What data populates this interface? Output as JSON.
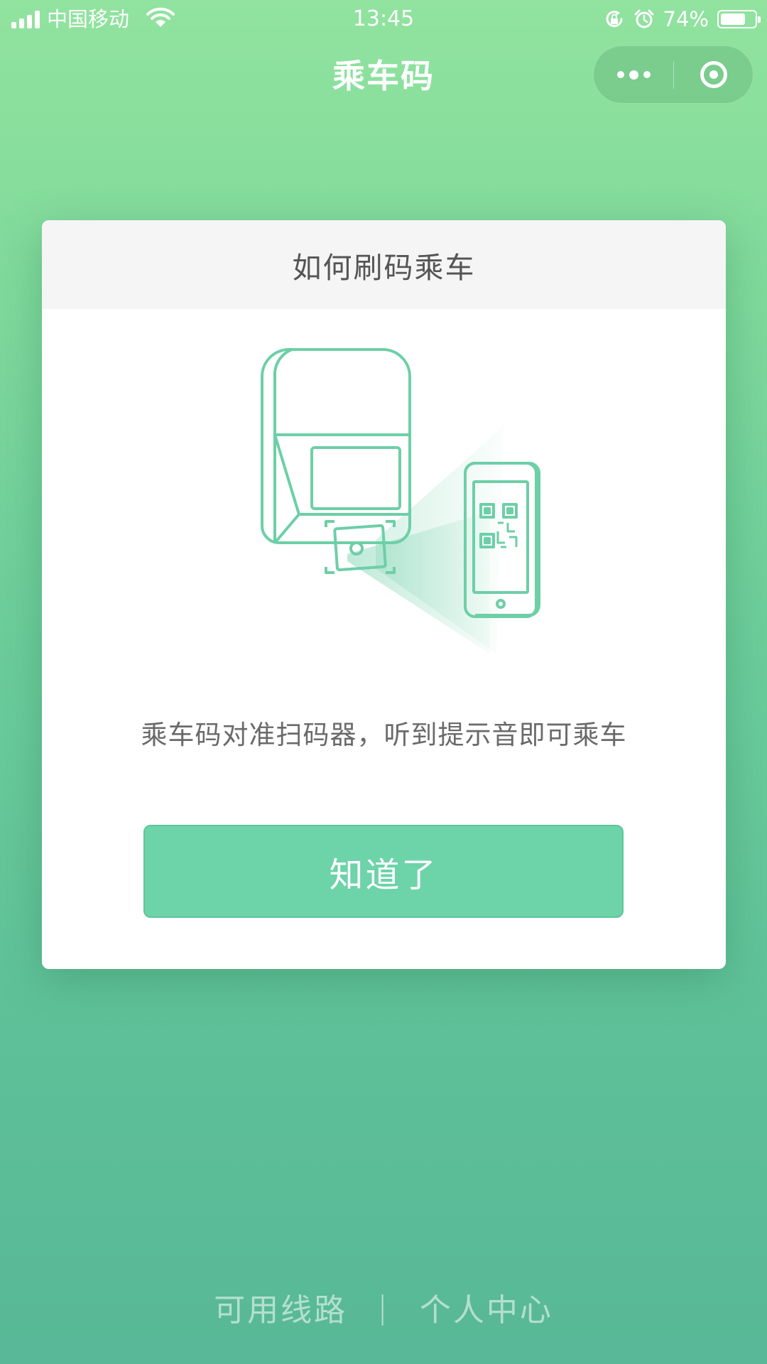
{
  "status_bar": {
    "carrier": "中国移动",
    "time": "13:45",
    "battery_percent_label": "74%",
    "battery_level": 0.74,
    "icons": [
      "signal-icon",
      "wifi-icon",
      "rotation-lock-icon",
      "alarm-icon",
      "battery-icon"
    ]
  },
  "nav": {
    "title": "乘车码",
    "more_icon": "more-dots-icon",
    "close_icon": "miniprogram-close-icon"
  },
  "dialog": {
    "title": "如何刷码乘车",
    "instruction": "乘车码对准扫码器，听到提示音即可乘车",
    "confirm_label": "知道了",
    "illustration": "scanner-and-phone-qr-illustration"
  },
  "bottom": {
    "routes_label": "可用线路",
    "separator": "|",
    "profile_label": "个人中心"
  },
  "colors": {
    "background_top": "#91e39f",
    "background_bottom": "#58b897",
    "accent": "#6dd3a9",
    "illustration_stroke": "#6dcfa7"
  }
}
